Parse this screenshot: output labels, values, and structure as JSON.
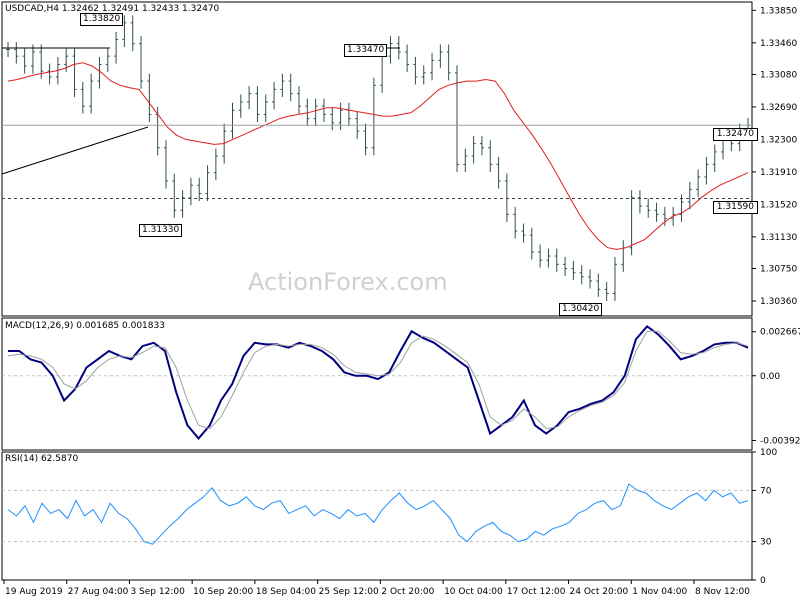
{
  "header": {
    "price_title": "USDCAD,H4  1.32462 1.32491 1.32433 1.32470",
    "macd_title": "MACD(12,26,9) 0.001685 0.001833",
    "rsi_title": "RSI(14) 62.5870"
  },
  "watermark": "ActionForex.com",
  "level_labels": [
    "1.33820",
    "1.33470",
    "1.31330",
    "1.30420"
  ],
  "current_price_tag": "1.32470",
  "support_tag": "1.31590",
  "colors": {
    "bars": "#2f4f4f",
    "ma": "#e02020",
    "macd": "#000080",
    "signal": "#a0a0a0",
    "rsi": "#1e90ff",
    "grid": "#c0c0c0"
  },
  "chart_data": [
    {
      "type": "bar",
      "name": "price",
      "title": "USDCAD,H4",
      "ohlc_header": [
        1.32462,
        1.32491,
        1.32433,
        1.3247
      ],
      "y_ticks": [
        1.3385,
        1.3346,
        1.3308,
        1.3269,
        1.323,
        1.3191,
        1.3152,
        1.3113,
        1.3075,
        1.3036
      ],
      "ylim": [
        1.3018,
        1.3395
      ],
      "current_price": 1.3247,
      "horizontal_level": 1.3159,
      "annotated_levels": [
        {
          "label": "1.33820",
          "value": 1.3382,
          "x_index": 14
        },
        {
          "label": "1.33470",
          "value": 1.3347,
          "x_index": 44
        },
        {
          "label": "1.31330",
          "value": 1.3133,
          "x_index": 20
        },
        {
          "label": "1.30420",
          "value": 1.3042,
          "x_index": 72
        }
      ],
      "closes": [
        1.3338,
        1.333,
        1.3318,
        1.3335,
        1.3312,
        1.3305,
        1.332,
        1.333,
        1.329,
        1.327,
        1.33,
        1.332,
        1.333,
        1.335,
        1.337,
        1.3345,
        1.33,
        1.326,
        1.322,
        1.318,
        1.3145,
        1.316,
        1.3175,
        1.3165,
        1.319,
        1.321,
        1.324,
        1.3265,
        1.3275,
        1.3285,
        1.326,
        1.3275,
        1.329,
        1.33,
        1.3285,
        1.327,
        1.3255,
        1.327,
        1.326,
        1.325,
        1.3265,
        1.3255,
        1.324,
        1.322,
        1.3295,
        1.333,
        1.3345,
        1.3335,
        1.332,
        1.3305,
        1.331,
        1.3325,
        1.3335,
        1.331,
        1.32,
        1.321,
        1.3225,
        1.322,
        1.32,
        1.318,
        1.314,
        1.312,
        1.3115,
        1.3095,
        1.3085,
        1.309,
        1.308,
        1.3075,
        1.307,
        1.3065,
        1.306,
        1.305,
        1.3045,
        1.308,
        1.31,
        1.316,
        1.315,
        1.3145,
        1.314,
        1.3135,
        1.314,
        1.3155,
        1.317,
        1.3185,
        1.32,
        1.3215,
        1.323,
        1.3225,
        1.324,
        1.3247
      ],
      "ma_values": [
        1.33,
        1.3302,
        1.3305,
        1.3308,
        1.331,
        1.3312,
        1.3315,
        1.332,
        1.3322,
        1.3318,
        1.331,
        1.33,
        1.3295,
        1.3292,
        1.329,
        1.3275,
        1.326,
        1.3245,
        1.3235,
        1.323,
        1.3228,
        1.3226,
        1.3224,
        1.3225,
        1.323,
        1.3235,
        1.324,
        1.3245,
        1.325,
        1.3255,
        1.3258,
        1.326,
        1.3262,
        1.3265,
        1.3268,
        1.3268,
        1.3266,
        1.3264,
        1.3262,
        1.326,
        1.3258,
        1.3258,
        1.326,
        1.3262,
        1.327,
        1.328,
        1.329,
        1.3295,
        1.3298,
        1.33,
        1.33,
        1.3302,
        1.33,
        1.3285,
        1.3265,
        1.325,
        1.3235,
        1.3218,
        1.32,
        1.318,
        1.316,
        1.314,
        1.3123,
        1.311,
        1.31,
        1.3098,
        1.31,
        1.3105,
        1.311,
        1.312,
        1.313,
        1.3138,
        1.3142,
        1.315,
        1.316,
        1.3168,
        1.3175,
        1.318,
        1.3185,
        1.319
      ],
      "x_tick_labels": [
        "19 Aug 2019",
        "27 Aug 04:00",
        "3 Sep 12:00",
        "10 Sep 20:00",
        "18 Sep 04:00",
        "25 Sep 12:00",
        "2 Oct 20:00",
        "10 Oct 04:00",
        "17 Oct 12:00",
        "24 Oct 20:00",
        "1 Nov 04:00",
        "8 Nov 12:00"
      ]
    },
    {
      "type": "line",
      "name": "macd",
      "title": "MACD(12,26,9)",
      "y_ticks": [
        0.002667,
        0.0,
        -0.003922
      ],
      "ylim": [
        -0.0045,
        0.0035
      ],
      "series": [
        {
          "name": "macd",
          "values": [
            0.0015,
            0.0015,
            0.001,
            0.0008,
            0.0,
            -0.0015,
            -0.0008,
            0.0005,
            0.001,
            0.0015,
            0.0012,
            0.001,
            0.0018,
            0.002,
            0.0015,
            -0.001,
            -0.003,
            -0.0038,
            -0.003,
            -0.0015,
            -0.0005,
            0.0012,
            0.002,
            0.0019,
            0.0019,
            0.0017,
            0.002,
            0.0018,
            0.0015,
            0.001,
            0.0002,
            0.0,
            0.0,
            -0.0002,
            0.0002,
            0.0015,
            0.0027,
            0.0023,
            0.002,
            0.0015,
            0.001,
            0.0005,
            -0.0015,
            -0.0035,
            -0.003,
            -0.0025,
            -0.0015,
            -0.003,
            -0.0035,
            -0.003,
            -0.0022,
            -0.002,
            -0.0017,
            -0.0015,
            -0.001,
            0.0,
            0.0022,
            0.003,
            0.0025,
            0.0018,
            0.001,
            0.0012,
            0.0015,
            0.0019,
            0.002,
            0.002,
            0.0017
          ]
        },
        {
          "name": "signal",
          "values": [
            0.0012,
            0.0013,
            0.0012,
            0.001,
            0.0005,
            -0.0005,
            -0.0008,
            -0.0003,
            0.0005,
            0.001,
            0.0012,
            0.0011,
            0.0014,
            0.0018,
            0.0017,
            0.0005,
            -0.0015,
            -0.003,
            -0.0032,
            -0.0025,
            -0.0012,
            0.0002,
            0.0014,
            0.0018,
            0.0019,
            0.0018,
            0.0019,
            0.0019,
            0.0017,
            0.0013,
            0.0006,
            0.0002,
            0.0001,
            0.0,
            0.0001,
            0.0008,
            0.002,
            0.0024,
            0.0022,
            0.0018,
            0.0013,
            0.0008,
            -0.0005,
            -0.0025,
            -0.003,
            -0.0027,
            -0.002,
            -0.0025,
            -0.0032,
            -0.0031,
            -0.0025,
            -0.0021,
            -0.0018,
            -0.0016,
            -0.0012,
            -0.0004,
            0.0015,
            0.0027,
            0.0027,
            0.0021,
            0.0014,
            0.0013,
            0.0014,
            0.0017,
            0.0019,
            0.002,
            0.0018
          ]
        }
      ]
    },
    {
      "type": "line",
      "name": "rsi",
      "title": "RSI(14)",
      "y_ticks": [
        100,
        70,
        30,
        0
      ],
      "ylim": [
        0,
        100
      ],
      "reference_lines": [
        70,
        30
      ],
      "series": [
        {
          "name": "rsi",
          "values": [
            55,
            50,
            58,
            45,
            60,
            52,
            55,
            48,
            62,
            50,
            55,
            45,
            60,
            52,
            48,
            40,
            30,
            28,
            35,
            42,
            48,
            55,
            60,
            65,
            72,
            62,
            58,
            60,
            65,
            58,
            55,
            60,
            62,
            52,
            55,
            58,
            50,
            55,
            52,
            48,
            55,
            50,
            52,
            45,
            55,
            62,
            68,
            60,
            55,
            58,
            62,
            55,
            48,
            35,
            30,
            38,
            42,
            45,
            38,
            35,
            30,
            32,
            38,
            35,
            40,
            42,
            45,
            52,
            55,
            60,
            62,
            55,
            58,
            75,
            70,
            68,
            62,
            58,
            55,
            60,
            65,
            68,
            62,
            70,
            65,
            68,
            60,
            62
          ]
        }
      ]
    }
  ]
}
